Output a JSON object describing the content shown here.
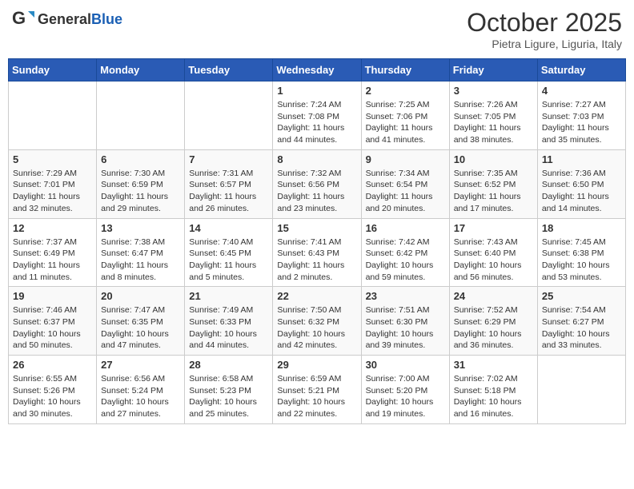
{
  "header": {
    "logo_general": "General",
    "logo_blue": "Blue",
    "month_title": "October 2025",
    "subtitle": "Pietra Ligure, Liguria, Italy"
  },
  "weekdays": [
    "Sunday",
    "Monday",
    "Tuesday",
    "Wednesday",
    "Thursday",
    "Friday",
    "Saturday"
  ],
  "weeks": [
    [
      {
        "day": "",
        "sunrise": "",
        "sunset": "",
        "daylight": ""
      },
      {
        "day": "",
        "sunrise": "",
        "sunset": "",
        "daylight": ""
      },
      {
        "day": "",
        "sunrise": "",
        "sunset": "",
        "daylight": ""
      },
      {
        "day": "1",
        "sunrise": "Sunrise: 7:24 AM",
        "sunset": "Sunset: 7:08 PM",
        "daylight": "Daylight: 11 hours and 44 minutes."
      },
      {
        "day": "2",
        "sunrise": "Sunrise: 7:25 AM",
        "sunset": "Sunset: 7:06 PM",
        "daylight": "Daylight: 11 hours and 41 minutes."
      },
      {
        "day": "3",
        "sunrise": "Sunrise: 7:26 AM",
        "sunset": "Sunset: 7:05 PM",
        "daylight": "Daylight: 11 hours and 38 minutes."
      },
      {
        "day": "4",
        "sunrise": "Sunrise: 7:27 AM",
        "sunset": "Sunset: 7:03 PM",
        "daylight": "Daylight: 11 hours and 35 minutes."
      }
    ],
    [
      {
        "day": "5",
        "sunrise": "Sunrise: 7:29 AM",
        "sunset": "Sunset: 7:01 PM",
        "daylight": "Daylight: 11 hours and 32 minutes."
      },
      {
        "day": "6",
        "sunrise": "Sunrise: 7:30 AM",
        "sunset": "Sunset: 6:59 PM",
        "daylight": "Daylight: 11 hours and 29 minutes."
      },
      {
        "day": "7",
        "sunrise": "Sunrise: 7:31 AM",
        "sunset": "Sunset: 6:57 PM",
        "daylight": "Daylight: 11 hours and 26 minutes."
      },
      {
        "day": "8",
        "sunrise": "Sunrise: 7:32 AM",
        "sunset": "Sunset: 6:56 PM",
        "daylight": "Daylight: 11 hours and 23 minutes."
      },
      {
        "day": "9",
        "sunrise": "Sunrise: 7:34 AM",
        "sunset": "Sunset: 6:54 PM",
        "daylight": "Daylight: 11 hours and 20 minutes."
      },
      {
        "day": "10",
        "sunrise": "Sunrise: 7:35 AM",
        "sunset": "Sunset: 6:52 PM",
        "daylight": "Daylight: 11 hours and 17 minutes."
      },
      {
        "day": "11",
        "sunrise": "Sunrise: 7:36 AM",
        "sunset": "Sunset: 6:50 PM",
        "daylight": "Daylight: 11 hours and 14 minutes."
      }
    ],
    [
      {
        "day": "12",
        "sunrise": "Sunrise: 7:37 AM",
        "sunset": "Sunset: 6:49 PM",
        "daylight": "Daylight: 11 hours and 11 minutes."
      },
      {
        "day": "13",
        "sunrise": "Sunrise: 7:38 AM",
        "sunset": "Sunset: 6:47 PM",
        "daylight": "Daylight: 11 hours and 8 minutes."
      },
      {
        "day": "14",
        "sunrise": "Sunrise: 7:40 AM",
        "sunset": "Sunset: 6:45 PM",
        "daylight": "Daylight: 11 hours and 5 minutes."
      },
      {
        "day": "15",
        "sunrise": "Sunrise: 7:41 AM",
        "sunset": "Sunset: 6:43 PM",
        "daylight": "Daylight: 11 hours and 2 minutes."
      },
      {
        "day": "16",
        "sunrise": "Sunrise: 7:42 AM",
        "sunset": "Sunset: 6:42 PM",
        "daylight": "Daylight: 10 hours and 59 minutes."
      },
      {
        "day": "17",
        "sunrise": "Sunrise: 7:43 AM",
        "sunset": "Sunset: 6:40 PM",
        "daylight": "Daylight: 10 hours and 56 minutes."
      },
      {
        "day": "18",
        "sunrise": "Sunrise: 7:45 AM",
        "sunset": "Sunset: 6:38 PM",
        "daylight": "Daylight: 10 hours and 53 minutes."
      }
    ],
    [
      {
        "day": "19",
        "sunrise": "Sunrise: 7:46 AM",
        "sunset": "Sunset: 6:37 PM",
        "daylight": "Daylight: 10 hours and 50 minutes."
      },
      {
        "day": "20",
        "sunrise": "Sunrise: 7:47 AM",
        "sunset": "Sunset: 6:35 PM",
        "daylight": "Daylight: 10 hours and 47 minutes."
      },
      {
        "day": "21",
        "sunrise": "Sunrise: 7:49 AM",
        "sunset": "Sunset: 6:33 PM",
        "daylight": "Daylight: 10 hours and 44 minutes."
      },
      {
        "day": "22",
        "sunrise": "Sunrise: 7:50 AM",
        "sunset": "Sunset: 6:32 PM",
        "daylight": "Daylight: 10 hours and 42 minutes."
      },
      {
        "day": "23",
        "sunrise": "Sunrise: 7:51 AM",
        "sunset": "Sunset: 6:30 PM",
        "daylight": "Daylight: 10 hours and 39 minutes."
      },
      {
        "day": "24",
        "sunrise": "Sunrise: 7:52 AM",
        "sunset": "Sunset: 6:29 PM",
        "daylight": "Daylight: 10 hours and 36 minutes."
      },
      {
        "day": "25",
        "sunrise": "Sunrise: 7:54 AM",
        "sunset": "Sunset: 6:27 PM",
        "daylight": "Daylight: 10 hours and 33 minutes."
      }
    ],
    [
      {
        "day": "26",
        "sunrise": "Sunrise: 6:55 AM",
        "sunset": "Sunset: 5:26 PM",
        "daylight": "Daylight: 10 hours and 30 minutes."
      },
      {
        "day": "27",
        "sunrise": "Sunrise: 6:56 AM",
        "sunset": "Sunset: 5:24 PM",
        "daylight": "Daylight: 10 hours and 27 minutes."
      },
      {
        "day": "28",
        "sunrise": "Sunrise: 6:58 AM",
        "sunset": "Sunset: 5:23 PM",
        "daylight": "Daylight: 10 hours and 25 minutes."
      },
      {
        "day": "29",
        "sunrise": "Sunrise: 6:59 AM",
        "sunset": "Sunset: 5:21 PM",
        "daylight": "Daylight: 10 hours and 22 minutes."
      },
      {
        "day": "30",
        "sunrise": "Sunrise: 7:00 AM",
        "sunset": "Sunset: 5:20 PM",
        "daylight": "Daylight: 10 hours and 19 minutes."
      },
      {
        "day": "31",
        "sunrise": "Sunrise: 7:02 AM",
        "sunset": "Sunset: 5:18 PM",
        "daylight": "Daylight: 10 hours and 16 minutes."
      },
      {
        "day": "",
        "sunrise": "",
        "sunset": "",
        "daylight": ""
      }
    ]
  ]
}
